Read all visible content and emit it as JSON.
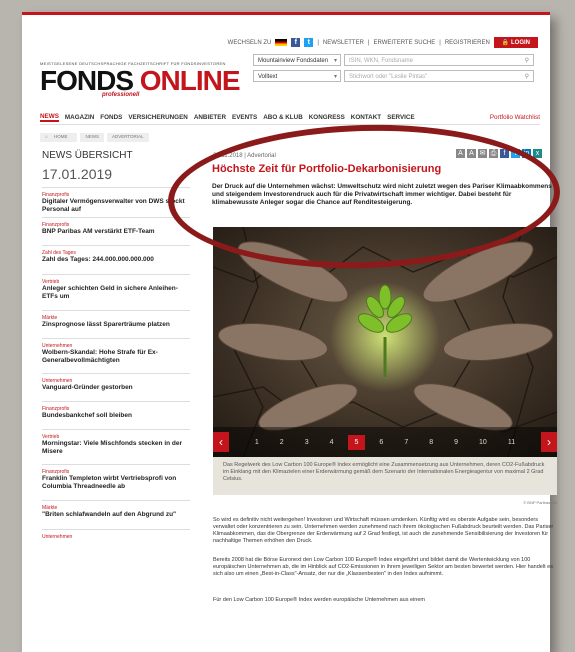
{
  "header": {
    "language_label": "WECHSELN ZU",
    "util_links": [
      "NEWSLETTER",
      "ERWEITERTE SUCHE",
      "REGISTRIEREN"
    ],
    "login_label": "LOGIN",
    "tagline": "MEISTGELESENE DEUTSCHSPRACHIGE FACHZEITSCHRIFT FÜR FONDSINVESTOREN",
    "logo_part1": "FONDS",
    "logo_part2": "ONLINE",
    "logo_sub": "professionell",
    "fund_select_value": "Mountainview Fondsdaten",
    "isin_placeholder": "ISIN, WKN, Fondsname",
    "scope_select_value": "Volltext",
    "search_placeholder": "Stichwort oder \"Leslie Pintas\""
  },
  "nav": {
    "items": [
      "NEWS",
      "MAGAZIN",
      "FONDS",
      "VERSICHERUNGEN",
      "ANBIETER",
      "EVENTS",
      "ABO & KLUB",
      "KONGRESS",
      "KONTAKT",
      "SERVICE"
    ],
    "right_label": "Portfolio  Watchlist"
  },
  "breadcrumb": [
    "HOME",
    "NEWS",
    "ADVERTORIAL"
  ],
  "sidebar": {
    "heading": "NEWS ÜBERSICHT",
    "date": "17.01.2019",
    "items": [
      {
        "category": "Finanzprofis",
        "title": "Digitaler Vermögensverwalter von DWS stockt Personal auf"
      },
      {
        "category": "Finanzprofis",
        "title": "BNP Paribas AM verstärkt ETF-Team"
      },
      {
        "category": "Zahl des Tages",
        "title": "Zahl des Tages: 244.000.000.000.000"
      },
      {
        "category": "Vertrieb",
        "title": "Anleger schichten Geld in sichere Anleihen-ETFs um"
      },
      {
        "category": "Märkte",
        "title": "Zinsprognose lässt Sparerträume platzen"
      },
      {
        "category": "Unternehmen",
        "title": "Wolbern-Skandal: Hohe Strafe für Ex-Generalbevollmächtigten"
      },
      {
        "category": "Unternehmen",
        "title": "Vanguard-Gründer gestorben"
      },
      {
        "category": "Finanzprofis",
        "title": "Bundesbankchef soll bleiben"
      },
      {
        "category": "Vertrieb",
        "title": "Morningstar: Viele Mischfonds stecken in der Misere"
      },
      {
        "category": "Finanzprofis",
        "title": "Franklin Templeton wirbt Vertriebsprofi von Columbia Threadneedle ab"
      },
      {
        "category": "Märkte",
        "title": "\"Briten schlafwandeln auf den Abgrund zu\""
      },
      {
        "category": "Unternehmen",
        "title": ""
      }
    ]
  },
  "article": {
    "meta": "28.11.2018 | Advertorial",
    "headline": "Höchste Zeit für Portfolio-Dekarbonisierung",
    "lead": "Der Druck auf die Unternehmen wächst: Umweltschutz wird nicht zuletzt wegen des Pariser Klimaabkommens und steigendem Investorendruck auch für die Privatwirtschaft immer wichtiger. Dabei besteht für klimabewusste Anleger sogar die Chance auf Renditesteigerung.",
    "pager_pages": [
      "1",
      "2",
      "3",
      "4",
      "5",
      "6",
      "7",
      "8",
      "9",
      "10",
      "11"
    ],
    "pager_active": "5",
    "caption": "Das Regelwerk des Low Carbon 100 Europe® Index ermöglicht eine Zusammensetzung aus Unternehmen, deren CO2-Fußabdruck im Einklang mit den Klimazielen einer Erderwärmung gemäß dem Szenario der Internationalen Energieagentur von maximal 2 Grad Celsius.",
    "credit": "© BNP Paribas AM",
    "paragraphs": [
      "So wird es definitiv nicht weitergehen! Investoren und Wirtschaft müssen umdenken. Künftig wird es oberste Aufgabe sein, besonders verwaltet oder konzentrieren zu sein. Unternehmen werden zunehmend nach ihrem ökologischen Fußabdruck beurteilt werden. Das Pariser Klimaabkommen, das die Obergrenze der Erderwärmung auf 2 Grad festlegt, ist auch die zunehmende Sensibilisierung der Investoren für nachhaltige Themen erhöhen den Druck.",
      "Bereits 2008 hat die Börse Euronext den Low Carbon 100 Europe® Index eingeführt und bildet damit die Wertentwicklung von 100 europäischen Unternehmen ab, die im Hinblick auf CO2-Emissionen in ihrem jeweiligen Sektor am besten bewertet werden. Hier handelt es sich also um einen „Best-in-Class\"-Ansatz, der nur die „Klassenbesten\" in den Index aufnimmt.",
      "Für den Low Carbon 100 Europe® Index werden europäische Unternehmen aus einem"
    ]
  }
}
